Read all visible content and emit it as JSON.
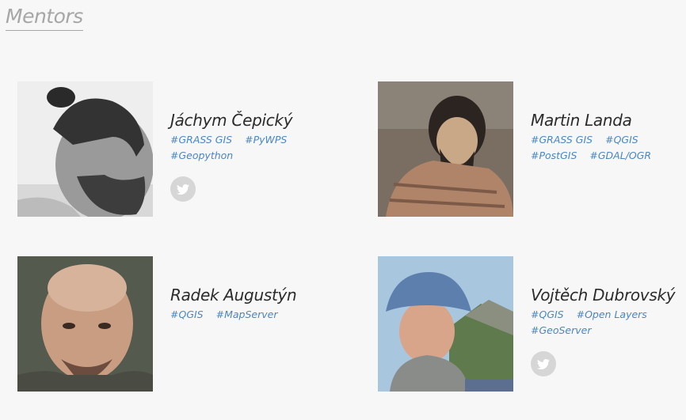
{
  "section": {
    "title": "Mentors"
  },
  "mentors": [
    {
      "name": "Jáchym Čepický",
      "tags": [
        "#GRASS GIS",
        "#PyWPS",
        "#Geopython"
      ],
      "twitter": true
    },
    {
      "name": "Martin Landa",
      "tags": [
        "#GRASS GIS",
        "#QGIS",
        "#PostGIS",
        "#GDAL/OGR"
      ],
      "twitter": false
    },
    {
      "name": "Radek Augustýn",
      "tags": [
        "#QGIS",
        "#MapServer"
      ],
      "twitter": false
    },
    {
      "name": "Vojtěch Dubrovský",
      "tags": [
        "#QGIS",
        "#Open Layers",
        "#GeoServer"
      ],
      "twitter": true
    }
  ],
  "colors": {
    "tag_link": "#4a86c0",
    "name": "#2b2b2b",
    "title": "#a6a6a6",
    "background": "#f7f7f7",
    "social_icon_bg": "#d6d6d6"
  },
  "icons": {
    "social": "twitter-bird-icon"
  }
}
